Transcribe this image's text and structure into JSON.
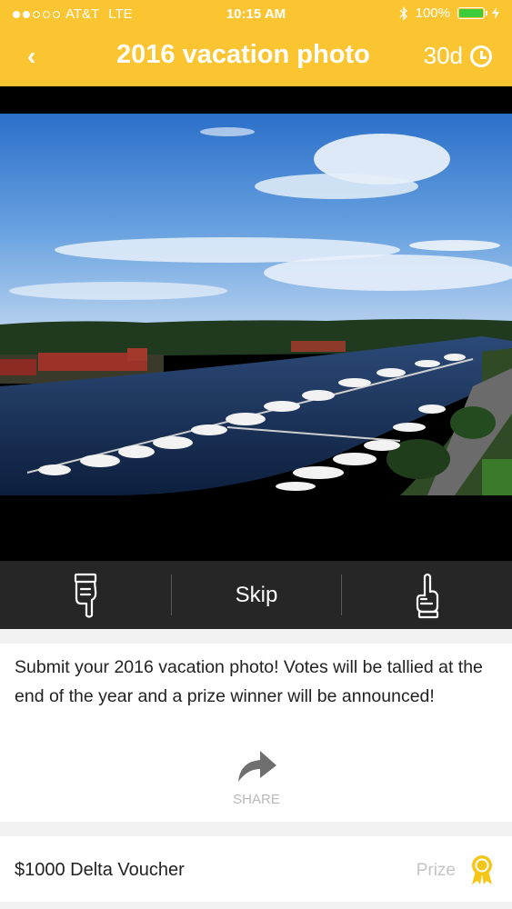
{
  "status_bar": {
    "carrier": "AT&T",
    "network": "LTE",
    "time": "10:15 AM",
    "battery": "100%"
  },
  "header": {
    "back_glyph": "‹",
    "title": "2016 vacation photo",
    "timer": "30d",
    "background_color": "#fbc531"
  },
  "actions": {
    "skip_label": "Skip",
    "downvote_icon": "thumbs-down-hand-icon",
    "upvote_icon": "pointing-up-hand-icon"
  },
  "post": {
    "description": "Submit your 2016 vacation photo! Votes will be tallied at the end of the year and a prize winner will be announced!",
    "share_label": "SHARE"
  },
  "prize": {
    "name": "$1000 Delta Voucher",
    "tag": "Prize",
    "icon": "award-ribbon-icon",
    "icon_color": "#f5c518"
  }
}
